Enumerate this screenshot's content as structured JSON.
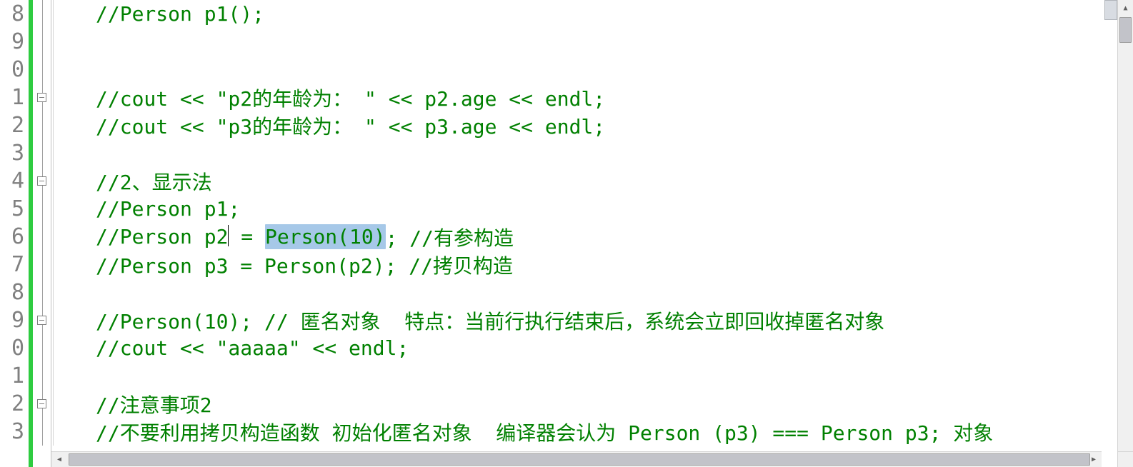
{
  "gutter": {
    "numbers": [
      "8",
      "9",
      "0",
      "1",
      "2",
      "3",
      "4",
      "5",
      "6",
      "7",
      "8",
      "9",
      "0",
      "1",
      "2",
      "3"
    ]
  },
  "fold": {
    "markers": [
      false,
      false,
      false,
      true,
      false,
      false,
      true,
      false,
      false,
      false,
      false,
      true,
      false,
      false,
      true,
      false
    ]
  },
  "code": {
    "l0_a": "//Person p1();",
    "l1_a": "",
    "l2_a": "",
    "l3_a": "//cout << \"p2的年龄为： \" << p2.age << endl;",
    "l4_a": "//cout << \"p3的年龄为： \" << p3.age << endl;",
    "l5_a": "",
    "l6_a": "//2、显示法",
    "l7_a": "//Person p1;",
    "l8_a": "//Person p2",
    "l8_b": " = ",
    "l8_hl": "Person(10)",
    "l8_c": "; //有参构造",
    "l9_a": "//Person p3 = Person(p2); //拷贝构造",
    "l10_a": "",
    "l11_a": "//Person(10); // 匿名对象  特点：当前行执行结束后，系统会立即回收掉匿名对象",
    "l12_a": "//cout << \"aaaaa\" << endl;",
    "l13_a": "",
    "l14_a": "//注意事项2",
    "l15_a": "//不要利用拷贝构造函数 初始化匿名对象  编译器会认为 Person (p3) === Person p3; 对象"
  },
  "scrollbar": {
    "up": "▲",
    "down": "▼",
    "left": "◀",
    "right": "▶"
  }
}
